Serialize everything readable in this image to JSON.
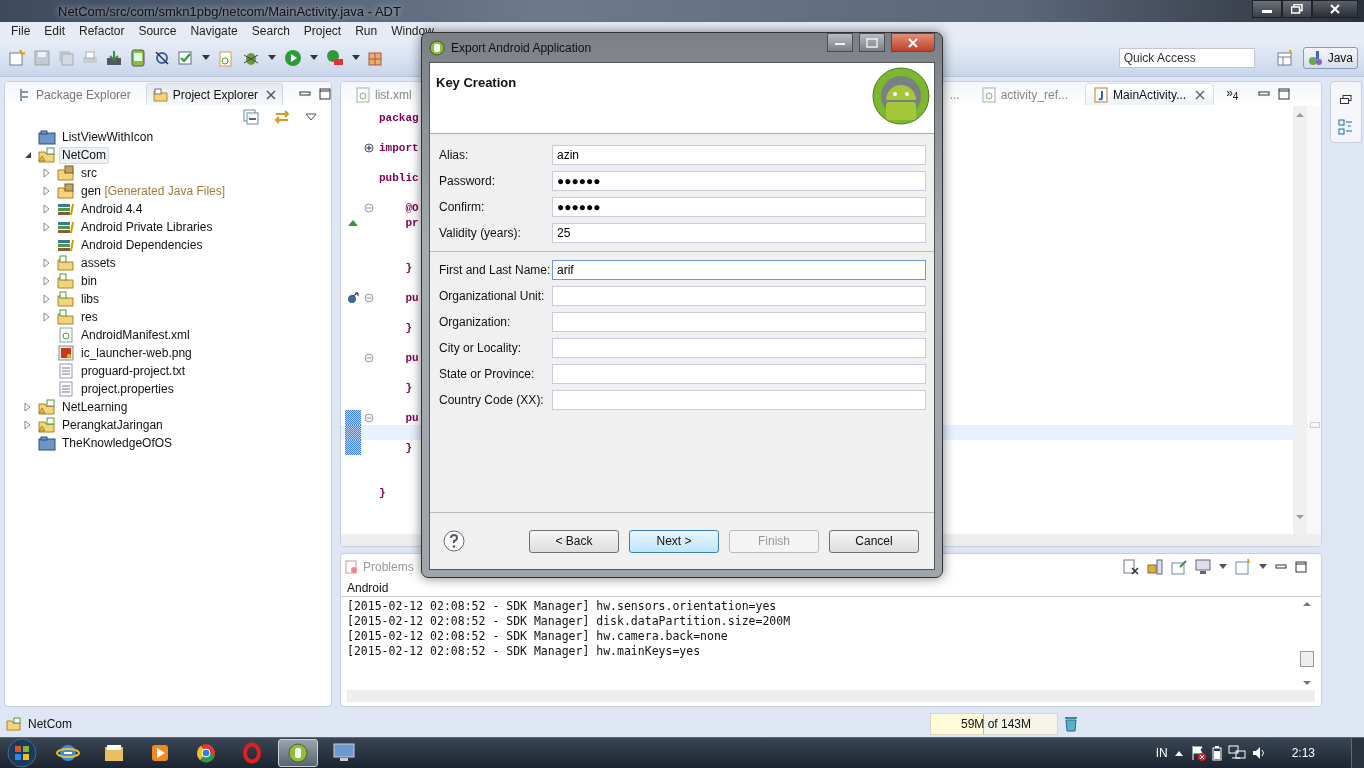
{
  "window": {
    "title": "NetCom/src/com/smkn1pbg/netcom/MainActivity.java - ADT"
  },
  "menu": [
    "File",
    "Edit",
    "Refactor",
    "Source",
    "Navigate",
    "Search",
    "Project",
    "Run",
    "Window"
  ],
  "toolbar": {
    "quick_access": {
      "placeholder": "Quick Access"
    },
    "perspective": {
      "label": "Java",
      "selected": true
    }
  },
  "explorer": {
    "tabs": [
      {
        "label": "Package Explorer",
        "selected": false
      },
      {
        "label": "Project Explorer",
        "selected": true
      }
    ],
    "tree": [
      {
        "label": "ListViewWithIcon",
        "kind": "closed-project",
        "arrow": false,
        "selected": false
      },
      {
        "label": "NetCom",
        "kind": "android-project",
        "arrow": true,
        "expanded": true,
        "selected": true,
        "children": [
          {
            "label": "src",
            "kind": "source-folder",
            "arrow": true,
            "expanded": false,
            "selected": false
          },
          {
            "label": "gen",
            "decoration": "[Generated Java Files]",
            "kind": "source-folder",
            "arrow": true,
            "expanded": false,
            "selected": false
          },
          {
            "label": "Android 4.4",
            "kind": "library",
            "arrow": true,
            "expanded": false,
            "selected": false
          },
          {
            "label": "Android Private Libraries",
            "kind": "library",
            "arrow": true,
            "expanded": false,
            "selected": false
          },
          {
            "label": "Android Dependencies",
            "kind": "library",
            "arrow": false,
            "selected": false
          },
          {
            "label": "assets",
            "kind": "folder",
            "arrow": true,
            "expanded": false,
            "selected": false
          },
          {
            "label": "bin",
            "kind": "folder",
            "arrow": true,
            "expanded": false,
            "selected": false
          },
          {
            "label": "libs",
            "kind": "folder",
            "arrow": true,
            "expanded": false,
            "selected": false
          },
          {
            "label": "res",
            "kind": "folder",
            "arrow": true,
            "expanded": false,
            "selected": false
          },
          {
            "label": "AndroidManifest.xml",
            "kind": "xml",
            "arrow": false,
            "selected": false
          },
          {
            "label": "ic_launcher-web.png",
            "kind": "image",
            "arrow": false,
            "selected": false
          },
          {
            "label": "proguard-project.txt",
            "kind": "text",
            "arrow": false,
            "selected": false
          },
          {
            "label": "project.properties",
            "kind": "text",
            "arrow": false,
            "selected": false
          }
        ]
      },
      {
        "label": "NetLearning",
        "kind": "android-project",
        "arrow": true,
        "expanded": false,
        "selected": false
      },
      {
        "label": "PerangkatJaringan",
        "kind": "android-project",
        "arrow": true,
        "expanded": false,
        "selected": false
      },
      {
        "label": "TheKnowledgeOfOS",
        "kind": "closed-project",
        "arrow": false,
        "selected": false
      }
    ]
  },
  "editor": {
    "tabs": [
      {
        "label": "list.xml",
        "kind": "xml",
        "selected": false
      },
      {
        "label": "...",
        "kind": "partial",
        "selected": false
      },
      {
        "label": "activity_ref...",
        "kind": "xml",
        "selected": false
      },
      {
        "label": "MainActivity...",
        "kind": "java",
        "selected": true
      }
    ],
    "overflow": {
      "glyph": "»",
      "count": "4"
    },
    "lines": [
      {
        "text": "packag",
        "current": false
      },
      {
        "current": false
      },
      {
        "text": "import",
        "fold": {
          "expanded": false
        },
        "current": false
      },
      {
        "current": false
      },
      {
        "text": "public",
        "current": false
      },
      {
        "current": false
      },
      {
        "text": "    @O",
        "fold": {
          "expanded": true
        },
        "current": false
      },
      {
        "text": "    pr",
        "ruler": {
          "kind": "override"
        },
        "current": false
      },
      {
        "current": false
      },
      {
        "current": false
      },
      {
        "text": "    }",
        "current": false
      },
      {
        "current": false
      },
      {
        "text": "    pu",
        "ruler": {
          "kind": "implements"
        },
        "fold": {
          "expanded": true
        },
        "current": false
      },
      {
        "current": false
      },
      {
        "text": "    }",
        "current": false
      },
      {
        "current": false
      },
      {
        "text": "    pu",
        "fold": {
          "expanded": true
        },
        "current": false
      },
      {
        "current": false
      },
      {
        "text": "    }",
        "current": false
      },
      {
        "current": false
      },
      {
        "text": "    pu",
        "ruler": {
          "kind": "changed"
        },
        "fold": {
          "expanded": true
        },
        "current": false
      },
      {
        "ruler": {
          "kind": "changed"
        },
        "current": true
      },
      {
        "text": "    }",
        "ruler": {
          "kind": "changed"
        },
        "current": false
      },
      {
        "current": false
      },
      {
        "current": false
      },
      {
        "text": "}",
        "current": false
      }
    ]
  },
  "console": {
    "tab": {
      "label": "Problems",
      "disabled": true
    },
    "name": "Android",
    "lines": [
      "[2015-02-12 02:08:52 - SDK Manager] hw.sensors.orientation=yes",
      "[2015-02-12 02:08:52 - SDK Manager] disk.dataPartition.size=200M",
      "[2015-02-12 02:08:52 - SDK Manager] hw.camera.back=none",
      "[2015-02-12 02:08:52 - SDK Manager] hw.mainKeys=yes"
    ]
  },
  "status_bar": {
    "label": "NetCom",
    "heap": {
      "text": "59M of 143M",
      "level": 0.41
    }
  },
  "dialog": {
    "title": "Export Android Application",
    "heading": "Key Creation",
    "keystore_fields": [
      {
        "label": "Alias:",
        "value": "azin",
        "focused": false
      },
      {
        "label": "Password:",
        "value": "●●●●●●",
        "focused": false
      },
      {
        "label": "Confirm:",
        "value": "●●●●●●",
        "focused": false
      },
      {
        "label": "Validity (years):",
        "value": "25",
        "focused": false
      }
    ],
    "certificate_fields": [
      {
        "label": "First and Last Name:",
        "value": "arif",
        "focused": true
      },
      {
        "label": "Organizational Unit:",
        "focused": false
      },
      {
        "label": "Organization:",
        "focused": false
      },
      {
        "label": "City or Locality:",
        "focused": false
      },
      {
        "label": "State or Province:",
        "focused": false
      },
      {
        "label": "Country Code (XX):",
        "focused": false
      }
    ],
    "buttons": [
      {
        "label": "< Back",
        "disabled": false,
        "default": false
      },
      {
        "label": "Next >",
        "disabled": false,
        "default": true
      },
      {
        "label": "Finish",
        "disabled": true,
        "default": false
      },
      {
        "label": "Cancel",
        "disabled": false,
        "default": false
      }
    ]
  },
  "taskbar": {
    "apps": [
      {
        "kind": "browser-e",
        "selected": false
      },
      {
        "kind": "folders",
        "selected": false
      },
      {
        "kind": "player",
        "selected": false
      },
      {
        "kind": "browser-round",
        "selected": false
      },
      {
        "kind": "browser-o",
        "selected": false
      },
      {
        "kind": "adt",
        "selected": true
      },
      {
        "kind": "remote",
        "selected": false
      }
    ],
    "language": "IN",
    "clock": "2:13"
  }
}
